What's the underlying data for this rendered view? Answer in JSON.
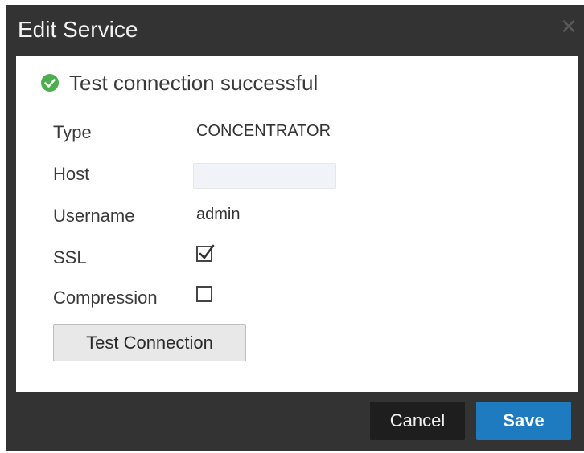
{
  "dialog": {
    "title": "Edit Service",
    "close_glyph": "×"
  },
  "status": {
    "icon": "check-circle-icon",
    "text": "Test connection successful",
    "color": "#4cae4c"
  },
  "fields": {
    "type_label": "Type",
    "type_value": "CONCENTRATOR",
    "host_label": "Host",
    "host_value": "",
    "username_label": "Username",
    "username_value": "admin",
    "ssl_label": "SSL",
    "ssl_checked": true,
    "compression_label": "Compression",
    "compression_checked": false
  },
  "buttons": {
    "test_connection": "Test Connection",
    "cancel": "Cancel",
    "save": "Save"
  },
  "colors": {
    "dialog_bg": "#333333",
    "primary": "#1f7bbf",
    "secondary_btn": "#1e1e1e"
  }
}
